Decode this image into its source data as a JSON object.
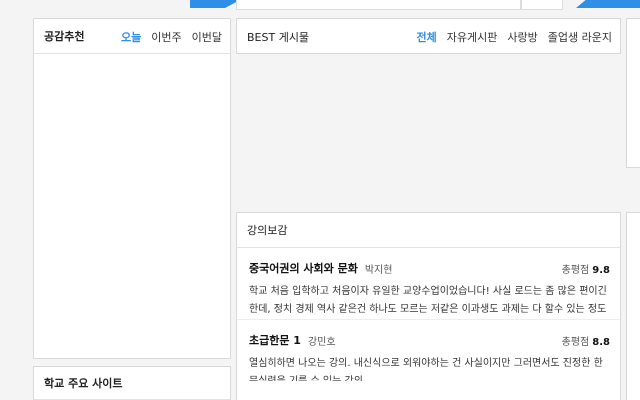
{
  "popular": {
    "title": "공감추천",
    "tabs": [
      "오늘",
      "이번주",
      "이번달"
    ]
  },
  "best": {
    "title": "BEST 게시물",
    "tabs": [
      "전체",
      "자유게시판",
      "사랑방",
      "졸업생 라운지"
    ]
  },
  "lecture_review": {
    "title": "강의보감",
    "score_label": "총평점",
    "reviews": [
      {
        "course": "중국어권의 사회와 문화",
        "professor": "박지현",
        "score": "9.8",
        "text": "학교 처음 입학하고 처음이자 유일한 교양수업이었습니다! 사실 로드는 좀 많은 편이긴한데, 정치 경제 역사 같은건 하나도 모르는 저같은 이과생도 과제는 다 할수 있는 정도의 난이도라서 괜찮았던 것"
      },
      {
        "course": "초급한문 1",
        "professor": "강민호",
        "score": "8.8",
        "text": "열심히하면 나오는 강의. 내신식으로 외워야하는 건 사실이지만 그러면서도 진정한 한문실력을 기를 수 있는 강의"
      }
    ]
  },
  "school_sites": {
    "title": "학교 주요 사이트"
  }
}
